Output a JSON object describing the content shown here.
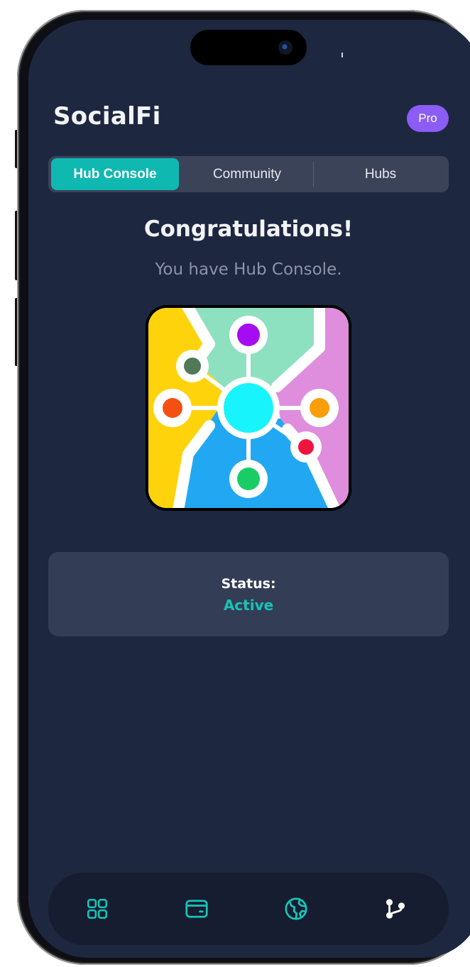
{
  "app": {
    "title": "SocialFi",
    "badge": "Pro"
  },
  "tabs": [
    {
      "label": "Hub Console",
      "active": true
    },
    {
      "label": "Community",
      "active": false
    },
    {
      "label": "Hubs",
      "active": false
    }
  ],
  "hero": {
    "heading": "Congratulations!",
    "message": "You have Hub Console.",
    "icon": "hub-network-icon"
  },
  "status": {
    "label": "Status:",
    "value": "Active"
  },
  "bottom_nav": {
    "items": [
      {
        "icon": "dashboard-grid-icon"
      },
      {
        "icon": "wallet-icon"
      },
      {
        "icon": "globe-icon"
      },
      {
        "icon": "branch-icon"
      }
    ]
  },
  "colors": {
    "background": "#1e2740",
    "accent": "#0fb8b0",
    "pro_badge": "#8b5cf6",
    "status_active": "#17c4b8"
  }
}
